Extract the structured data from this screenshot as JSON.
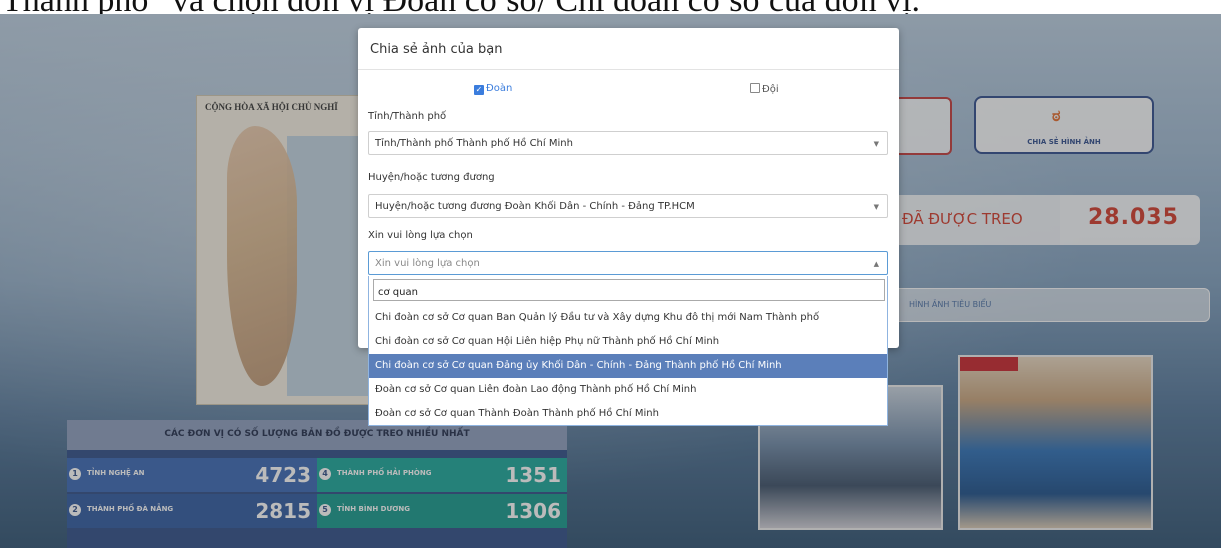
{
  "caption": "Thành phố” và chọn đơn vị Đoàn cơ sở/ Chi đoàn cơ sở của đơn vị.",
  "map": {
    "title": "CỘNG HÒA XÃ HỘI CHỦ NGHĨ"
  },
  "share": {
    "label": "CHIA SẺ HÌNH ẢNH",
    "icon": "share-photos-icon"
  },
  "counter": {
    "label": "ĐÃ ĐƯỢC TREO",
    "value": "28.035"
  },
  "featured": {
    "label": "HÌNH ẢNH TIÊU BIỂU"
  },
  "stats": {
    "heading": "CÁC ĐƠN VỊ CÓ SỐ LƯỢNG BẢN ĐỒ ĐƯỢC TREO NHIỀU NHẤT",
    "rows": [
      {
        "rank": "1",
        "name": "TỈNH NGHỆ AN",
        "value": "4723"
      },
      {
        "rank": "4",
        "name": "THÀNH PHỐ HẢI PHÒNG",
        "value": "1351"
      },
      {
        "rank": "2",
        "name": "THÀNH PHỐ ĐÀ NẴNG",
        "value": "2815"
      },
      {
        "rank": "5",
        "name": "TỈNH BÌNH DƯƠNG",
        "value": "1306"
      }
    ]
  },
  "modal": {
    "title": "Chia sẻ ảnh của bạn",
    "option_doan": "Đoàn",
    "option_doi": "Đội",
    "province_label": "Tỉnh/Thành phố",
    "province_value": "Tỉnh/Thành phố Thành phố Hồ Chí Minh",
    "district_label": "Huyện/hoặc tương đương",
    "district_value": "Huyện/hoặc tương đương Đoàn Khối Dân - Chính - Đảng TP.HCM",
    "unit_label": "Xin vui lòng lựa chọn",
    "unit_placeholder": "Xin vui lòng lựa chọn"
  },
  "dropdown": {
    "search_value": "cơ quan",
    "items": [
      "Chi đoàn cơ sở Cơ quan Ban Quản lý Đầu tư và Xây dựng Khu đô thị mới Nam Thành phố",
      "Chi đoàn cơ sở Cơ quan Hội Liên hiệp Phụ nữ Thành phố Hồ Chí Minh",
      "Chi đoàn cơ sở Cơ quan Đảng ủy Khối Dân - Chính - Đảng Thành phố Hồ Chí Minh",
      "Đoàn cơ sở Cơ quan Liên đoàn Lao động Thành phố Hồ Chí Minh",
      "Đoàn cơ sở Cơ quan Thành Đoàn Thành phố Hồ Chí Minh"
    ],
    "highlighted_index": 2
  },
  "colors": {
    "accent": "#3b7ddd",
    "highlight": "#5b7fba",
    "counter": "#d23a2a",
    "panel": "#2f4e88"
  }
}
